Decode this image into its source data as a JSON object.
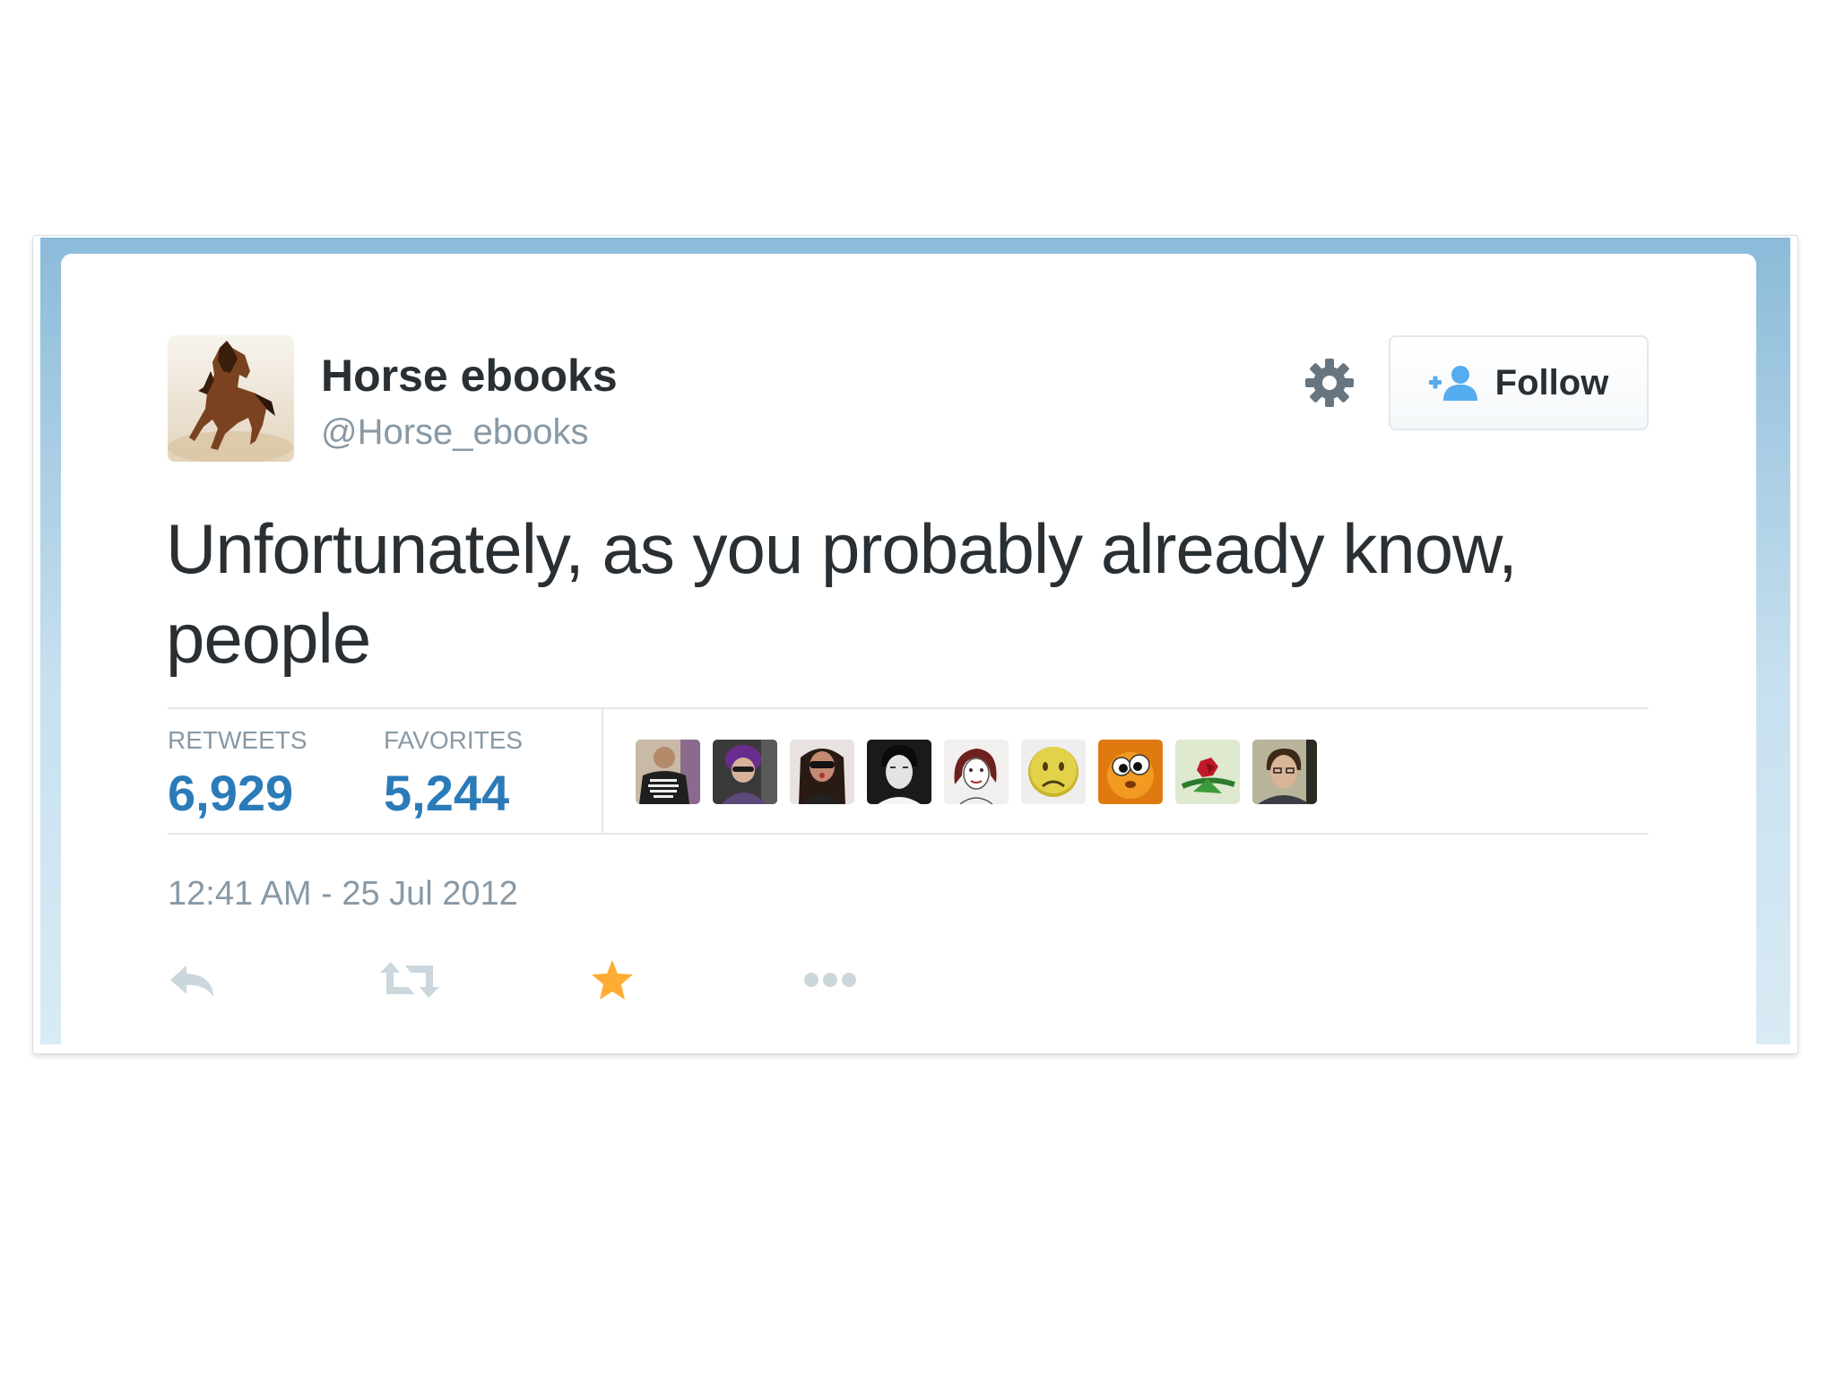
{
  "tweet": {
    "display_name": "Horse ebooks",
    "handle": "@Horse_ebooks",
    "text": "Unfortunately, as you probably already know, people",
    "follow_label": "Follow",
    "stats": {
      "retweets_label": "RETWEETS",
      "retweets_count": "6,929",
      "favorites_label": "FAVORITES",
      "favorites_count": "5,244"
    },
    "timestamp": "12:41 AM - 25 Jul 2012",
    "favorited_by_avatars": [
      "avatar-man-tshirt",
      "avatar-purple-hair",
      "avatar-woman-sunglasses",
      "avatar-bw-portrait",
      "avatar-sketch-face",
      "avatar-sad-face",
      "avatar-googly-eyes",
      "avatar-red-flower",
      "avatar-man-portrait"
    ],
    "actions": [
      "reply-icon",
      "retweet-icon",
      "favorite-icon",
      "more-icon"
    ]
  },
  "colors": {
    "link_blue": "#2b7bb9",
    "muted_gray": "#8899a6",
    "text_dark": "#292f33",
    "favorite_orange": "#ffac33",
    "follow_icon_blue": "#55acee"
  }
}
